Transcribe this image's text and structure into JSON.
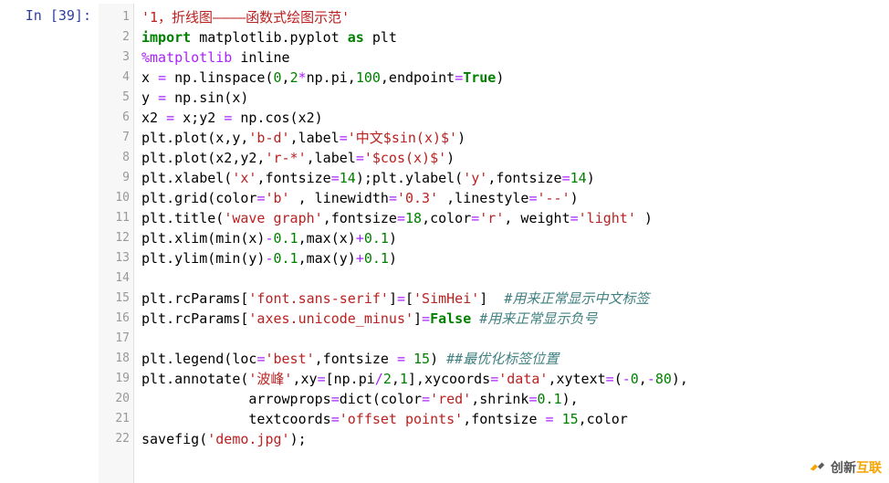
{
  "prompt": {
    "label": "In",
    "num": "[39]:"
  },
  "lines": {
    "count": 22
  },
  "code": {
    "l1": {
      "s1": "'1，折线图————函数式绘图示范'"
    },
    "l2": {
      "kw1": "import",
      "id1": " matplotlib.pyplot ",
      "kw2": "as",
      "id2": " plt"
    },
    "l3": {
      "mag": "%matplotlib",
      "arg": " inline"
    },
    "l4": {
      "a": "x ",
      "eq": "=",
      "b": " np.linspace(",
      "n1": "0",
      "c1": ",",
      "n2": "2",
      "op1": "*",
      "c2": "np.pi,",
      "n3": "100",
      "c3": ",endpoint",
      "eq2": "=",
      "kw": "True",
      "c4": ")"
    },
    "l5": {
      "a": "y ",
      "eq": "=",
      "b": " np.sin(x)"
    },
    "l6": {
      "a": "x2 ",
      "eq": "=",
      "b": " x;y2 ",
      "eq2": "=",
      "c": " np.cos(x2)"
    },
    "l7": {
      "a": "plt.plot(x,y,",
      "s1": "'b-d'",
      "b": ",label",
      "eq": "=",
      "s2": "'中文$sin(x)$'",
      "c": ")"
    },
    "l8": {
      "a": "plt.plot(x2,y2,",
      "s1": "'r-*'",
      "b": ",label",
      "eq": "=",
      "s2": "'$cos(x)$'",
      "c": ")"
    },
    "l9": {
      "a": "plt.xlabel(",
      "s1": "'x'",
      "b": ",fontsize",
      "eq": "=",
      "n1": "14",
      "c": ");plt.ylabel(",
      "s2": "'y'",
      "d": ",fontsize",
      "eq2": "=",
      "n2": "14",
      "e": ")"
    },
    "l10": {
      "a": "plt.grid(color",
      "eq": "=",
      "s1": "'b'",
      "b": " , linewidth",
      "eq2": "=",
      "s2": "'0.3'",
      "c": " ,linestyle",
      "eq3": "=",
      "s3": "'--'",
      "d": ")"
    },
    "l11": {
      "a": "plt.title(",
      "s1": "'wave graph'",
      "b": ",fontsize",
      "eq": "=",
      "n1": "18",
      "c": ",color",
      "eq2": "=",
      "s2": "'r'",
      "d": ", weight",
      "eq3": "=",
      "s3": "'light'",
      "e": " )"
    },
    "l12": {
      "a": "plt.xlim(min(x)",
      "op1": "-",
      "n1": "0.1",
      "b": ",max(x)",
      "op2": "+",
      "n2": "0.1",
      "c": ")"
    },
    "l13": {
      "a": "plt.ylim(min(y)",
      "op1": "-",
      "n1": "0.1",
      "b": ",max(y)",
      "op2": "+",
      "n2": "0.1",
      "c": ")"
    },
    "l14": {
      "blank": ""
    },
    "l15": {
      "a": "plt.rcParams[",
      "s1": "'font.sans-serif'",
      "b": "]",
      "eq": "=",
      "c": "[",
      "s2": "'SimHei'",
      "d": "]  ",
      "com": "#用来正常显示中文标签"
    },
    "l16": {
      "a": "plt.rcParams[",
      "s1": "'axes.unicode_minus'",
      "b": "]",
      "eq": "=",
      "kw": "False",
      "sp": " ",
      "com": "#用来正常显示负号"
    },
    "l17": {
      "blank": ""
    },
    "l18": {
      "a": "plt.legend(loc",
      "eq": "=",
      "s1": "'best'",
      "b": ",fontsize ",
      "eq2": "=",
      "sp": " ",
      "n1": "15",
      "c": ") ",
      "com": "##最优化标签位置"
    },
    "l19": {
      "a": "plt.annotate(",
      "s1": "'波峰'",
      "b": ",xy",
      "eq": "=",
      "c": "[np.pi",
      "op": "/",
      "n1": "2",
      "d": ",",
      "n2": "1",
      "e": "],xycoords",
      "eq2": "=",
      "s2": "'data'",
      "f": ",xytext",
      "eq3": "=",
      "g": "(",
      "op2": "-",
      "n3": "0",
      "h": ",",
      "op3": "-",
      "n4": "80",
      "i": "),"
    },
    "l20": {
      "pad": "             ",
      "a": "arrowprops",
      "eq": "=",
      "b": "dict(color",
      "eq2": "=",
      "s1": "'red'",
      "c": ",shrink",
      "eq3": "=",
      "n1": "0.1",
      "d": "),"
    },
    "l21": {
      "pad": "             ",
      "a": "textcoords",
      "eq": "=",
      "s1": "'offset points'",
      "b": ",fontsize ",
      "eq2": "=",
      "sp": " ",
      "n1": "15",
      "c": ",color"
    },
    "l22": {
      "a": "savefig(",
      "s1": "'demo.jpg'",
      "b": ");"
    }
  },
  "logo": {
    "t1": "创新",
    "t2": "互联"
  }
}
